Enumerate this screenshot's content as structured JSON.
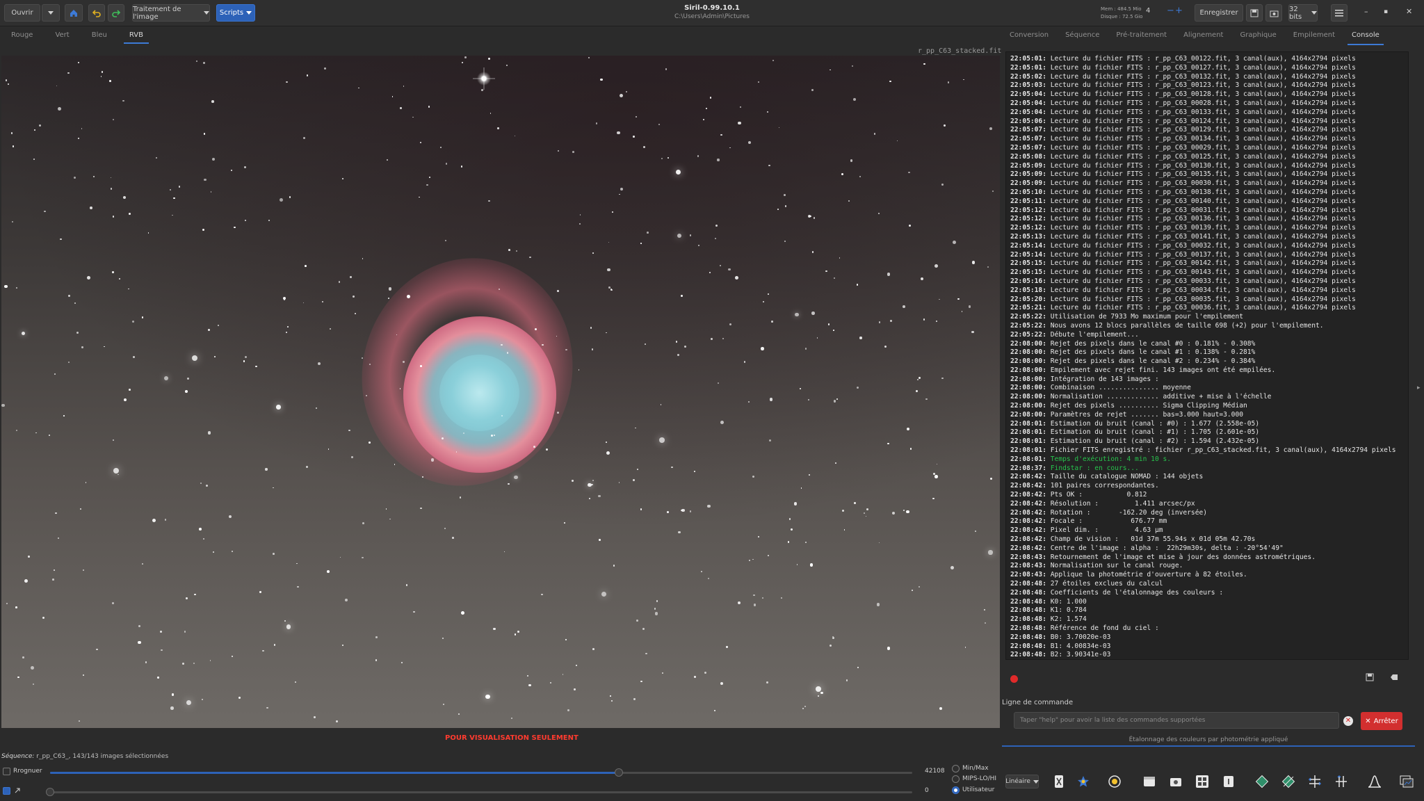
{
  "window": {
    "title": "Siril-0.99.10.1",
    "path": "C:\\Users\\Admin\\Pictures",
    "mem": "Mem : 484.5 Mio",
    "disk": "Disque : 72.5 Gio"
  },
  "toolbar": {
    "open_label": "Ouvrir",
    "processing_label": "Traitement de l'image",
    "scripts_label": "Scripts",
    "threads_value": "4",
    "save_label": "Enregistrer",
    "bits_label": "32 bits"
  },
  "channel_tabs": [
    "Rouge",
    "Vert",
    "Bleu",
    "RVB"
  ],
  "active_channel": "RVB",
  "image": {
    "filename": "r_pp_C63_stacked.fit",
    "watermark": "POUR VISUALISATION SEULEMENT"
  },
  "right_tabs": [
    "Conversion",
    "Séquence",
    "Pré-traitement",
    "Alignement",
    "Graphique",
    "Empilement",
    "Console"
  ],
  "active_right_tab": "Console",
  "console": {
    "lines": [
      [
        "22:05:01:",
        "Lecture du fichier FITS : r_pp_C63_00122.fit, 3 canal(aux), 4164x2794 pixels",
        ""
      ],
      [
        "22:05:01:",
        "Lecture du fichier FITS : r_pp_C63_00127.fit, 3 canal(aux), 4164x2794 pixels",
        ""
      ],
      [
        "22:05:02:",
        "Lecture du fichier FITS : r_pp_C63_00132.fit, 3 canal(aux), 4164x2794 pixels",
        ""
      ],
      [
        "22:05:03:",
        "Lecture du fichier FITS : r_pp_C63_00123.fit, 3 canal(aux), 4164x2794 pixels",
        ""
      ],
      [
        "22:05:04:",
        "Lecture du fichier FITS : r_pp_C63_00128.fit, 3 canal(aux), 4164x2794 pixels",
        ""
      ],
      [
        "22:05:04:",
        "Lecture du fichier FITS : r_pp_C63_00028.fit, 3 canal(aux), 4164x2794 pixels",
        ""
      ],
      [
        "22:05:04:",
        "Lecture du fichier FITS : r_pp_C63_00133.fit, 3 canal(aux), 4164x2794 pixels",
        ""
      ],
      [
        "22:05:06:",
        "Lecture du fichier FITS : r_pp_C63_00124.fit, 3 canal(aux), 4164x2794 pixels",
        ""
      ],
      [
        "22:05:07:",
        "Lecture du fichier FITS : r_pp_C63_00129.fit, 3 canal(aux), 4164x2794 pixels",
        ""
      ],
      [
        "22:05:07:",
        "Lecture du fichier FITS : r_pp_C63_00134.fit, 3 canal(aux), 4164x2794 pixels",
        ""
      ],
      [
        "22:05:07:",
        "Lecture du fichier FITS : r_pp_C63_00029.fit, 3 canal(aux), 4164x2794 pixels",
        ""
      ],
      [
        "22:05:08:",
        "Lecture du fichier FITS : r_pp_C63_00125.fit, 3 canal(aux), 4164x2794 pixels",
        ""
      ],
      [
        "22:05:09:",
        "Lecture du fichier FITS : r_pp_C63_00130.fit, 3 canal(aux), 4164x2794 pixels",
        ""
      ],
      [
        "22:05:09:",
        "Lecture du fichier FITS : r_pp_C63_00135.fit, 3 canal(aux), 4164x2794 pixels",
        ""
      ],
      [
        "22:05:09:",
        "Lecture du fichier FITS : r_pp_C63_00030.fit, 3 canal(aux), 4164x2794 pixels",
        ""
      ],
      [
        "22:05:10:",
        "Lecture du fichier FITS : r_pp_C63_00138.fit, 3 canal(aux), 4164x2794 pixels",
        ""
      ],
      [
        "22:05:11:",
        "Lecture du fichier FITS : r_pp_C63_00140.fit, 3 canal(aux), 4164x2794 pixels",
        ""
      ],
      [
        "22:05:12:",
        "Lecture du fichier FITS : r_pp_C63_00031.fit, 3 canal(aux), 4164x2794 pixels",
        ""
      ],
      [
        "22:05:12:",
        "Lecture du fichier FITS : r_pp_C63_00136.fit, 3 canal(aux), 4164x2794 pixels",
        ""
      ],
      [
        "22:05:12:",
        "Lecture du fichier FITS : r_pp_C63_00139.fit, 3 canal(aux), 4164x2794 pixels",
        ""
      ],
      [
        "22:05:13:",
        "Lecture du fichier FITS : r_pp_C63_00141.fit, 3 canal(aux), 4164x2794 pixels",
        ""
      ],
      [
        "22:05:14:",
        "Lecture du fichier FITS : r_pp_C63_00032.fit, 3 canal(aux), 4164x2794 pixels",
        ""
      ],
      [
        "22:05:14:",
        "Lecture du fichier FITS : r_pp_C63_00137.fit, 3 canal(aux), 4164x2794 pixels",
        ""
      ],
      [
        "22:05:15:",
        "Lecture du fichier FITS : r_pp_C63_00142.fit, 3 canal(aux), 4164x2794 pixels",
        ""
      ],
      [
        "22:05:15:",
        "Lecture du fichier FITS : r_pp_C63_00143.fit, 3 canal(aux), 4164x2794 pixels",
        ""
      ],
      [
        "22:05:16:",
        "Lecture du fichier FITS : r_pp_C63_00033.fit, 3 canal(aux), 4164x2794 pixels",
        ""
      ],
      [
        "22:05:18:",
        "Lecture du fichier FITS : r_pp_C63_00034.fit, 3 canal(aux), 4164x2794 pixels",
        ""
      ],
      [
        "22:05:20:",
        "Lecture du fichier FITS : r_pp_C63_00035.fit, 3 canal(aux), 4164x2794 pixels",
        ""
      ],
      [
        "22:05:21:",
        "Lecture du fichier FITS : r_pp_C63_00036.fit, 3 canal(aux), 4164x2794 pixels",
        ""
      ],
      [
        "22:05:22:",
        "Utilisation de 7933 Mo maximum pour l'empilement",
        ""
      ],
      [
        "22:05:22:",
        "Nous avons 12 blocs parallèles de taille 698 (+2) pour l'empilement.",
        ""
      ],
      [
        "22:05:22:",
        "Débute l'empilement...",
        ""
      ],
      [
        "22:08:00:",
        "Rejet des pixels dans le canal #0 : 0.181% - 0.308%",
        ""
      ],
      [
        "22:08:00:",
        "Rejet des pixels dans le canal #1 : 0.138% - 0.281%",
        ""
      ],
      [
        "22:08:00:",
        "Rejet des pixels dans le canal #2 : 0.234% - 0.384%",
        ""
      ],
      [
        "22:08:00:",
        "Empilement avec rejet fini. 143 images ont été empilées.",
        ""
      ],
      [
        "22:08:00:",
        "Intégration de 143 images :",
        ""
      ],
      [
        "22:08:00:",
        "Combinaison ............... moyenne",
        ""
      ],
      [
        "22:08:00:",
        "Normalisation ............. additive + mise à l'échelle",
        ""
      ],
      [
        "22:08:00:",
        "Rejet des pixels .......... Sigma Clipping Médian",
        ""
      ],
      [
        "22:08:00:",
        "Paramètres de rejet ....... bas=3.000 haut=3.000",
        ""
      ],
      [
        "22:08:01:",
        "Estimation du bruit (canal : #0) : 1.677 (2.558e-05)",
        ""
      ],
      [
        "22:08:01:",
        "Estimation du bruit (canal : #1) : 1.705 (2.601e-05)",
        ""
      ],
      [
        "22:08:01:",
        "Estimation du bruit (canal : #2) : 1.594 (2.432e-05)",
        ""
      ],
      [
        "22:08:01:",
        "Fichier FITS enregistré : fichier r_pp_C63_stacked.fit, 3 canal(aux), 4164x2794 pixels",
        ""
      ],
      [
        "22:08:01:",
        "Temps d'exécution: 4 min 10 s.",
        "green"
      ],
      [
        "22:08:37:",
        "Findstar : en cours...",
        "green"
      ],
      [
        "22:08:42:",
        "Taille du catalogue NOMAD : 144 objets",
        ""
      ],
      [
        "22:08:42:",
        "101 paires correspondantes.",
        ""
      ],
      [
        "22:08:42:",
        "Pts OK :           0.812",
        ""
      ],
      [
        "22:08:42:",
        "Résolution :         1.411 arcsec/px",
        ""
      ],
      [
        "22:08:42:",
        "Rotation :       -162.20 deg (inversée)",
        ""
      ],
      [
        "22:08:42:",
        "Focale :            676.77 mm",
        ""
      ],
      [
        "22:08:42:",
        "Pixel dim. :         4.63 µm",
        ""
      ],
      [
        "22:08:42:",
        "Champ de vision :   01d 37m 55.94s x 01d 05m 42.70s",
        ""
      ],
      [
        "22:08:42:",
        "Centre de l'image : alpha :  22h29m30s, delta : -20°54'49\"",
        ""
      ],
      [
        "22:08:43:",
        "Retournement de l'image et mise à jour des données astrométriques.",
        ""
      ],
      [
        "22:08:43:",
        "Normalisation sur le canal rouge.",
        ""
      ],
      [
        "22:08:43:",
        "Applique la photométrie d'ouverture à 82 étoiles.",
        ""
      ],
      [
        "22:08:48:",
        "27 étoiles exclues du calcul",
        ""
      ],
      [
        "22:08:48:",
        "Coefficients de l'étalonnage des couleurs :",
        ""
      ],
      [
        "22:08:48:",
        "K0: 1.000",
        ""
      ],
      [
        "22:08:48:",
        "K1: 0.784",
        ""
      ],
      [
        "22:08:48:",
        "K2: 1.574",
        ""
      ],
      [
        "22:08:48:",
        "Référence de fond du ciel :",
        ""
      ],
      [
        "22:08:48:",
        "B0: 3.70020e-03",
        ""
      ],
      [
        "22:08:48:",
        "B1: 4.00834e-03",
        ""
      ],
      [
        "22:08:48:",
        "B2: 3.90341e-03",
        ""
      ]
    ]
  },
  "command": {
    "label": "Ligne de commande",
    "placeholder": "Taper \"help\" pour avoir la liste des commandes supportées",
    "stop_label": "Arrêter",
    "status": "Étalonnage des couleurs par photométrie appliqué"
  },
  "bottom": {
    "sequence_label": "Séquence:",
    "sequence_text": " r_pp_C63_, 143/143 images sélectionnées",
    "crop_label": "Rrognuer",
    "high_value": "42108",
    "low_value": "0",
    "high_fraction": 0.66,
    "low_fraction": 0.0,
    "scale_options": [
      "Min/Max",
      "MIPS-LO/HI",
      "Utilisateur"
    ],
    "selected_scale": "Utilisateur",
    "stretch_label": "Linéaire"
  },
  "colors": {
    "accent": "#2d62b8",
    "stop": "#d22f2f",
    "console_green": "#27c24c",
    "watermark": "#ff3b2f"
  }
}
